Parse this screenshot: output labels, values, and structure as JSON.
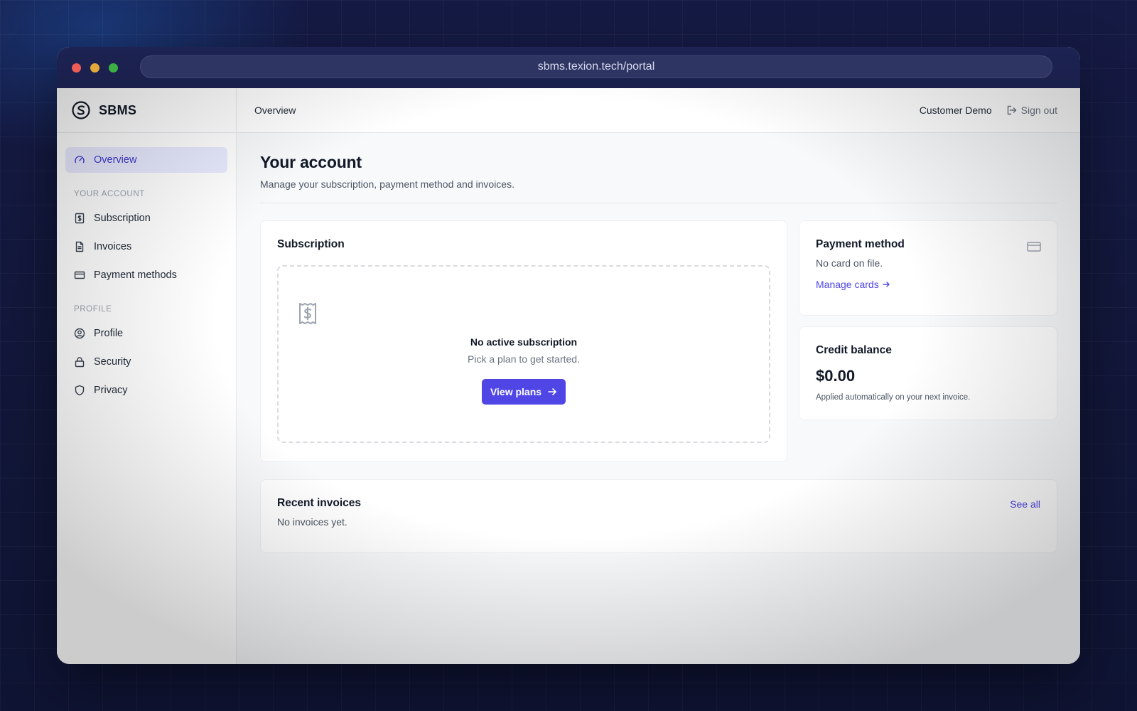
{
  "browser": {
    "url": "sbms.texion.tech/portal"
  },
  "brand": {
    "name": "SBMS"
  },
  "sidebar": {
    "overview": "Overview",
    "sections": [
      {
        "title": "YOUR ACCOUNT",
        "items": [
          "Subscription",
          "Invoices",
          "Payment methods"
        ]
      },
      {
        "title": "PROFILE",
        "items": [
          "Profile",
          "Security",
          "Privacy"
        ]
      }
    ]
  },
  "header": {
    "breadcrumb": "Overview",
    "user": "Customer Demo",
    "sign_out": "Sign out"
  },
  "page": {
    "title": "Your account",
    "subtitle": "Manage your subscription, payment method and invoices."
  },
  "subscription": {
    "title": "Subscription",
    "empty_title": "No active subscription",
    "empty_sub": "Pick a plan to get started.",
    "button": "View plans"
  },
  "payment": {
    "title": "Payment method",
    "status": "No card on file.",
    "link": "Manage cards"
  },
  "credit": {
    "title": "Credit balance",
    "amount": "$0.00",
    "note": "Applied automatically on your next invoice."
  },
  "invoices": {
    "title": "Recent invoices",
    "see_all": "See all",
    "empty": "No invoices yet."
  },
  "colors": {
    "accent": "#4f46e5",
    "active_bg": "#e8eaff"
  }
}
